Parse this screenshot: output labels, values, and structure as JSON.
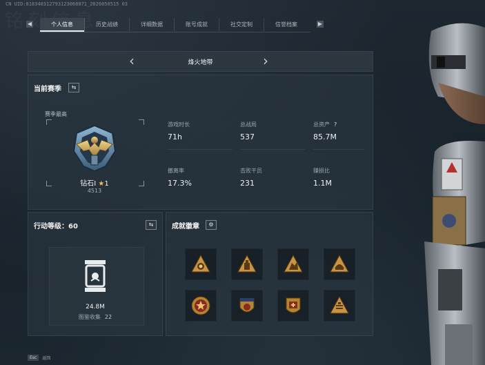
{
  "uid": "CN UID:818340312793123068071_2026050515 03",
  "watermark": "铭刻信息",
  "tabs": [
    {
      "label": "个人信息",
      "active": true
    },
    {
      "label": "历史战绩",
      "active": false
    },
    {
      "label": "详细数据",
      "active": false
    },
    {
      "label": "账号成就",
      "active": false
    },
    {
      "label": "社交定制",
      "active": false
    },
    {
      "label": "信誉档案",
      "active": false
    }
  ],
  "tab_nav": {
    "left_icon": "chevron-left-icon",
    "right_icon": "chevron-right-icon"
  },
  "season_selector": {
    "name": "烽火地带"
  },
  "current_season": {
    "title": "当前赛季",
    "season_best_label": "赛季最高",
    "rank_name": "钻石I",
    "rank_stars": "1",
    "rank_score": "4513",
    "stats": [
      {
        "label": "游戏时长",
        "value": "71h"
      },
      {
        "label": "总战局",
        "value": "537"
      },
      {
        "label": "总资产",
        "value": "85.7M",
        "help": "?"
      },
      {
        "label": "撤离率",
        "value": "17.3%"
      },
      {
        "label": "击败干员",
        "value": "231"
      },
      {
        "label": "赚损比",
        "value": "1.1M"
      }
    ]
  },
  "level": {
    "title": "行动等级：60",
    "value": "24.8M",
    "collection_label": "图鉴收集",
    "collection_value": "22"
  },
  "badges": {
    "title": "成就徽章",
    "items": [
      "badge-1",
      "badge-2",
      "badge-3",
      "badge-4",
      "badge-5",
      "badge-6",
      "badge-7",
      "badge-8"
    ]
  },
  "footer": {
    "key": "Esc",
    "label": "返回"
  },
  "colors": {
    "accent": "#c8a05a",
    "panel": "#28343e",
    "active_tab": "#3a454e"
  }
}
